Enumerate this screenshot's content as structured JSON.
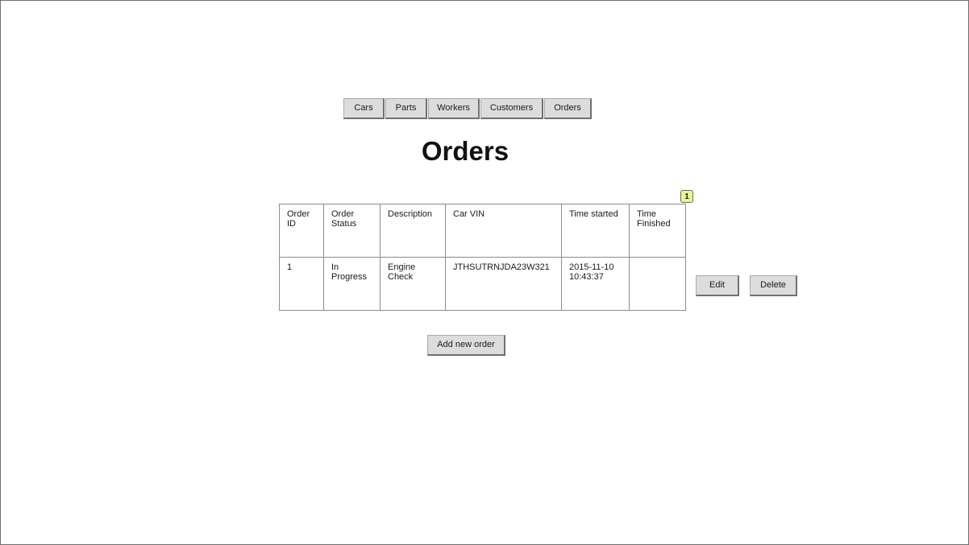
{
  "nav": {
    "cars": "Cars",
    "parts": "Parts",
    "workers": "Workers",
    "customers": "Customers",
    "orders": "Orders"
  },
  "page_title": "Orders",
  "annotation_badge": "1",
  "table": {
    "headers": [
      "Order ID",
      "Order Status",
      "Description",
      "Car VIN",
      "Time started",
      "Time Finished"
    ],
    "rows": [
      [
        "1",
        "In Progress",
        "Engine Check",
        "JTHSUTRNJDA23W321",
        "2015-11-10 10:43:37",
        ""
      ]
    ]
  },
  "row_actions": {
    "edit": "Edit",
    "delete": "Delete"
  },
  "add_button": "Add new order"
}
